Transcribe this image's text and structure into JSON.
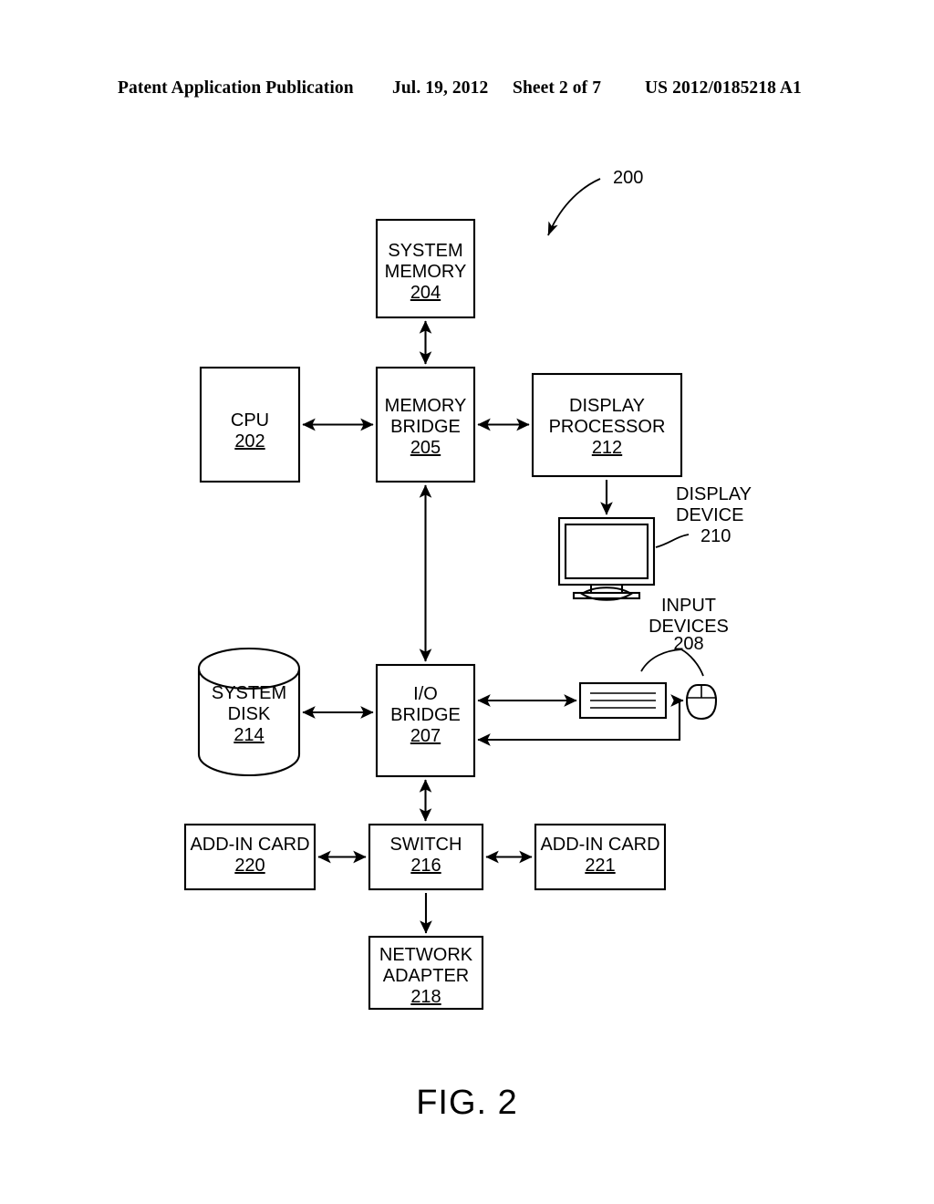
{
  "header": {
    "publication": "Patent Application Publication",
    "date": "Jul. 19, 2012",
    "sheet": "Sheet 2 of 7",
    "patent_number": "US 2012/0185218 A1"
  },
  "figure": {
    "caption": "FIG. 2",
    "system_callout": "200"
  },
  "nodes": {
    "system_memory": {
      "line1": "SYSTEM",
      "line2": "MEMORY",
      "ref": "204"
    },
    "cpu": {
      "line1": "CPU",
      "ref": "202"
    },
    "memory_bridge": {
      "line1": "MEMORY",
      "line2": "BRIDGE",
      "ref": "205"
    },
    "display_processor": {
      "line1": "DISPLAY",
      "line2": "PROCESSOR",
      "ref": "212"
    },
    "display_device": {
      "line1": "DISPLAY",
      "line2": "DEVICE",
      "ref": "210"
    },
    "input_devices": {
      "line1": "INPUT",
      "line2": "DEVICES",
      "ref": "208"
    },
    "system_disk": {
      "line1": "SYSTEM",
      "line2": "DISK",
      "ref": "214"
    },
    "io_bridge": {
      "line1": "I/O",
      "line2": "BRIDGE",
      "ref": "207"
    },
    "add_in_card_left": {
      "line1": "ADD-IN CARD",
      "ref": "220"
    },
    "switch": {
      "line1": "SWITCH",
      "ref": "216"
    },
    "add_in_card_right": {
      "line1": "ADD-IN CARD",
      "ref": "221"
    },
    "network_adapter": {
      "line1": "NETWORK",
      "line2": "ADAPTER",
      "ref": "218"
    }
  },
  "colors": {
    "ink": "#000000",
    "paper": "#ffffff"
  }
}
